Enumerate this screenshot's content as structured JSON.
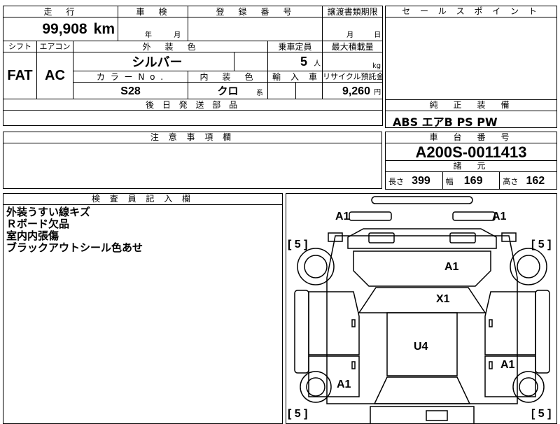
{
  "top_grid": {
    "mileage_header": "走　行",
    "mileage_value": "99,908",
    "mileage_unit": "km",
    "inspection_header": "車　検",
    "inspection_year_unit": "年",
    "inspection_month_unit": "月",
    "registration_header": "登　録　番　号",
    "registration_value": "",
    "transfer_header": "譲渡書類期限",
    "transfer_month_unit": "月",
    "transfer_day_unit": "日",
    "shift_header": "シフト",
    "shift_value": "FAT",
    "aircon_header": "エアコン",
    "aircon_value": "AC",
    "exterior_color_header": "外　装　色",
    "exterior_color_value": "シルバー",
    "capacity_header": "乗車定員",
    "capacity_value": "5",
    "capacity_unit": "人",
    "load_header": "最大積載量",
    "load_unit": "kg",
    "color_no_header": "カ ラ ー N o .",
    "color_no_value": "S28",
    "interior_header": "内　装　色",
    "interior_value": "クロ",
    "interior_suffix": "系",
    "import_header": "輸　入　車",
    "recycle_header": "リサイクル預託金",
    "recycle_value": "9,260",
    "recycle_unit": "円",
    "later_parts_header": "後 日 発 送 部 品"
  },
  "sales_point": {
    "header": "セ ー ル ス ポ イ ン ト"
  },
  "equipment": {
    "header": "純　正　装　備",
    "value": "ABS エアB PS PW"
  },
  "caution": {
    "header": "注 意 事 項 欄"
  },
  "chassis": {
    "header": "車　台　番　号",
    "value": "A200S-0011413"
  },
  "specs": {
    "header": "諸　元",
    "length_label": "長さ",
    "length_value": "399",
    "width_label": "幅",
    "width_value": "169",
    "height_label": "高さ",
    "height_value": "162"
  },
  "inspector_notes": {
    "header": "検 査 員 記 入 欄",
    "lines": [
      "外装うすい線キズ",
      "Ｒボード欠品",
      "室内内張傷",
      "ブラックアウトシール色あせ"
    ]
  },
  "car_map": {
    "labels": {
      "front_left": "A1",
      "front_right": "A1",
      "hood": "A1",
      "windshield": "X1",
      "roof": "U4",
      "rear_left": "A1",
      "rear_right": "A1",
      "tire_fl": "[ 5 ]",
      "tire_fr": "[ 5 ]",
      "tire_rl": "[ 5 ]",
      "tire_rr": "[ 5 ]"
    }
  }
}
